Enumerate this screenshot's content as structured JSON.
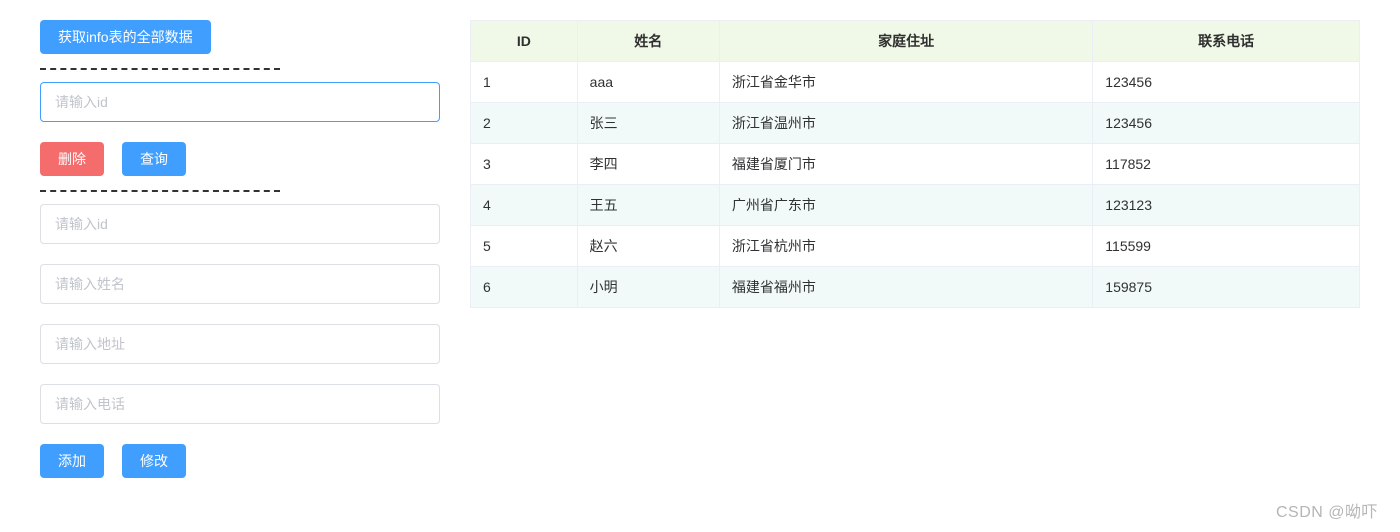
{
  "left": {
    "fetch_all_btn": "获取info表的全部数据",
    "id_input_placeholder": "请输入id",
    "delete_btn": "删除",
    "query_btn": "查询",
    "add_form": {
      "id_placeholder": "请输入id",
      "name_placeholder": "请输入姓名",
      "address_placeholder": "请输入地址",
      "phone_placeholder": "请输入电话",
      "add_btn": "添加",
      "modify_btn": "修改"
    }
  },
  "table": {
    "headers": {
      "id": "ID",
      "name": "姓名",
      "address": "家庭住址",
      "phone": "联系电话"
    },
    "rows": [
      {
        "id": "1",
        "name": "aaa",
        "address": "浙江省金华市",
        "phone": "123456"
      },
      {
        "id": "2",
        "name": "张三",
        "address": "浙江省温州市",
        "phone": "123456"
      },
      {
        "id": "3",
        "name": "李四",
        "address": "福建省厦门市",
        "phone": "117852"
      },
      {
        "id": "4",
        "name": "王五",
        "address": "广州省广东市",
        "phone": "123123"
      },
      {
        "id": "5",
        "name": "赵六",
        "address": "浙江省杭州市",
        "phone": "115599"
      },
      {
        "id": "6",
        "name": "小明",
        "address": "福建省福州市",
        "phone": "159875"
      }
    ]
  },
  "watermark": "CSDN @呦吓"
}
